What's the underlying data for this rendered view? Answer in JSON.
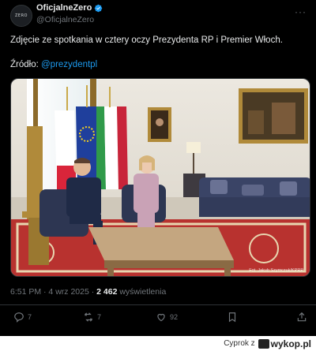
{
  "author": {
    "display_name": "OficjalneZero",
    "handle": "@OficjalneZero",
    "avatar_text": "ZERO"
  },
  "tweet": {
    "text": "Zdjęcie ze spotkania w cztery oczy Prezydenta RP i Premier Włoch.",
    "source_label": "Źródło: ",
    "source_mention": "@prezydentpl",
    "more_label": "···"
  },
  "photo": {
    "watermark": "Fot. Jakub Szymczuk/KPRP"
  },
  "meta": {
    "time_date": "6:51 PM · 4 wrz 2025 · ",
    "views_count": "2 462",
    "views_label": " wyświetlenia"
  },
  "actions": {
    "replies": "7",
    "retweets": "7",
    "likes": "92"
  },
  "footer": {
    "cyprok_label": "Cyprok  z",
    "brand": "wykop.pl"
  },
  "colors": {
    "background": "#000000",
    "text": "#e7e9ea",
    "muted": "#71767b",
    "accent": "#1d9bf0"
  }
}
